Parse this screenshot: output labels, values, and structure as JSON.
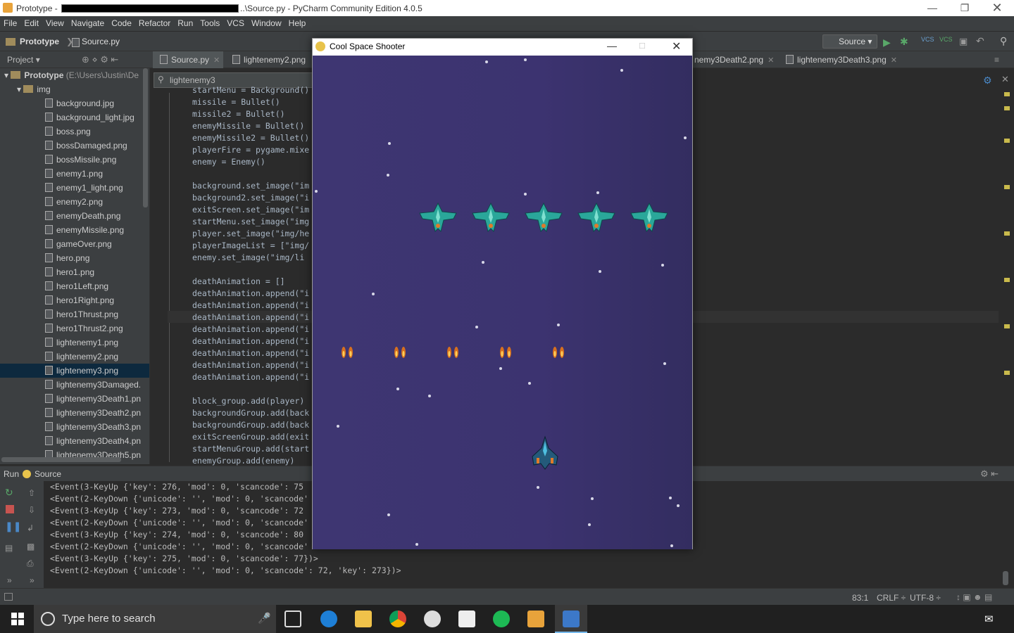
{
  "titlebar": {
    "prefix": "Prototype - ",
    "suffix": "..\\Source.py - PyCharm Community Edition 4.0.5"
  },
  "menu": [
    "File",
    "Edit",
    "View",
    "Navigate",
    "Code",
    "Refactor",
    "Run",
    "Tools",
    "VCS",
    "Window",
    "Help"
  ],
  "nav": {
    "project": "Prototype",
    "file": "Source.py",
    "run_config": "Source"
  },
  "tabs": [
    {
      "label": "Source.py"
    },
    {
      "label": "lightenemy2.png"
    },
    {
      "label": "nemy3Death2.png"
    },
    {
      "label": "lightenemy3Death3.png"
    }
  ],
  "project_panel": {
    "header": "Project",
    "root": "Prototype",
    "root_path": "(E:\\Users\\Justin\\De",
    "folder": "img",
    "files": [
      "background.jpg",
      "background_light.jpg",
      "boss.png",
      "bossDamaged.png",
      "bossMissile.png",
      "enemy1.png",
      "enemy1_light.png",
      "enemy2.png",
      "enemyDeath.png",
      "enemyMissile.png",
      "gameOver.png",
      "hero.png",
      "hero1.png",
      "hero1Left.png",
      "hero1Right.png",
      "hero1Thrust.png",
      "hero1Thrust2.png",
      "lightenemy1.png",
      "lightenemy2.png",
      "lightenemy3.png",
      "lightenemy3Damaged.",
      "lightenemy3Death1.pn",
      "lightenemy3Death2.pn",
      "lightenemy3Death3.pn",
      "lightenemy3Death4.pn",
      "lightenemy3Death5.pn"
    ],
    "selected": "lightenemy3.png"
  },
  "search": {
    "value": "lightenemy3"
  },
  "code": [
    "startMenu = Background()",
    "missile = Bullet()",
    "missile2 = Bullet()",
    "enemyMissile = Bullet()",
    "enemyMissile2 = Bullet()",
    "playerFire = pygame.mixe",
    "enemy = Enemy()",
    "",
    "background.set_image(\"im",
    "background2.set_image(\"i",
    "exitScreen.set_image(\"im",
    "startMenu.set_image(\"img",
    "player.set_image(\"img/he",
    "playerImageList = [\"img/",
    "enemy.set_image(\"img/li",
    "",
    "deathAnimation = []",
    "deathAnimation.append(\"i",
    "deathAnimation.append(\"i",
    "deathAnimation.append(\"i",
    "deathAnimation.append(\"i",
    "deathAnimation.append(\"i",
    "deathAnimation.append(\"i",
    "deathAnimation.append(\"i",
    "deathAnimation.append(\"i",
    "",
    "block_group.add(player)",
    "backgroundGroup.add(back",
    "backgroundGroup.add(back",
    "exitScreenGroup.add(exit",
    "startMenuGroup.add(start",
    "enemyGroup.add(enemy)"
  ],
  "run": {
    "label": "Run",
    "config": "Source",
    "lines": [
      "<Event(3-KeyUp {'key': 276, 'mod': 0, 'scancode': 75",
      "<Event(2-KeyDown {'unicode': '', 'mod': 0, 'scancode'",
      "<Event(3-KeyUp {'key': 273, 'mod': 0, 'scancode': 72",
      "<Event(2-KeyDown {'unicode': '', 'mod': 0, 'scancode'",
      "<Event(3-KeyUp {'key': 274, 'mod': 0, 'scancode': 80",
      "<Event(2-KeyDown {'unicode': '', 'mod': 0, 'scancode'",
      "<Event(3-KeyUp {'key': 275, 'mod': 0, 'scancode': 77})>",
      "<Event(2-KeyDown {'unicode': '', 'mod': 0, 'scancode': 72, 'key': 273})>"
    ]
  },
  "status": {
    "position": "83:1",
    "line_sep": "CRLF ÷",
    "encoding": "UTF-8 ÷"
  },
  "game": {
    "title": "Cool Space Shooter"
  },
  "taskbar": {
    "search_placeholder": "Type here to search"
  }
}
